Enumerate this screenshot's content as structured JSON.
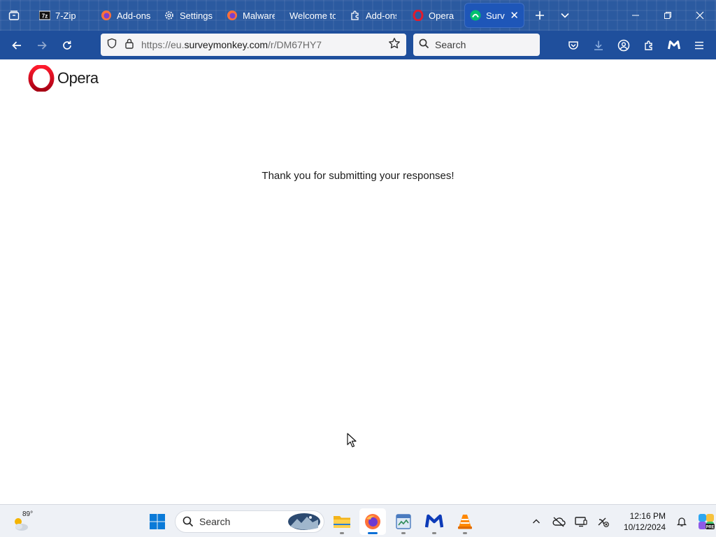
{
  "browser": {
    "tabs": [
      {
        "label": "7-Zip",
        "favicon": "7zip-icon"
      },
      {
        "label": "Add-ons",
        "favicon": "firefox-icon"
      },
      {
        "label": "Settings",
        "favicon": "gear-icon"
      },
      {
        "label": "Malware",
        "favicon": "firefox-icon"
      },
      {
        "label": "Welcome to",
        "favicon": "none"
      },
      {
        "label": "Add-ons",
        "favicon": "puzzle-icon"
      },
      {
        "label": "Opera W",
        "favicon": "opera-icon"
      },
      {
        "label": "Surve",
        "favicon": "surveymonkey-icon",
        "active": true
      }
    ],
    "url": {
      "prefix": "https://eu.",
      "host": "surveymonkey.com",
      "path": "/r/DM67HY7"
    },
    "search_placeholder": "Search",
    "colors": {
      "tabstrip": "#2b5aa0",
      "toolbar": "#1f4f9c",
      "active_tab": "#1e56b8"
    }
  },
  "page": {
    "logo_text": "Opera",
    "message": "Thank you for submitting your responses!"
  },
  "taskbar": {
    "weather_temp": "89°",
    "search_label": "Search",
    "clock_time": "12:16 PM",
    "clock_date": "10/12/2024"
  }
}
